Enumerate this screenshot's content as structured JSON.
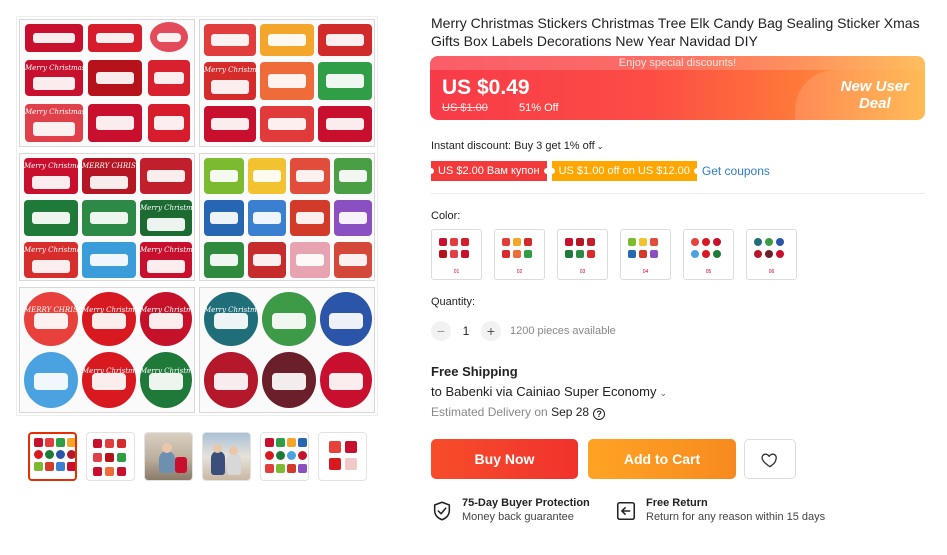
{
  "product": {
    "title": "Merry Christmas Stickers Christmas Tree Elk Candy Bag Sealing Sticker Xmas Gifts Box Labels Decorations New Year Navidad DIY"
  },
  "gallery": {
    "thumbnails": [
      "thumb-1",
      "thumb-2",
      "thumb-3",
      "thumb-4",
      "thumb-5",
      "thumb-6"
    ],
    "active_index": 0,
    "sticker_text": {
      "merry_christmas": "Merry Christmas",
      "merry_christmas_caps": "MERRY CHRISTMAS"
    }
  },
  "price": {
    "promo_strip": "Enjoy special discounts!",
    "current": "US $0.49",
    "original": "US $1.00",
    "discount": "51% Off",
    "deal_line1": "New User",
    "deal_line2": "Deal"
  },
  "instant_discount": "Instant discount: Buy 3 get 1% off",
  "coupons": {
    "coupon1": "US $2.00 Вам купон",
    "coupon2": "US $1.00 off on US $12.00",
    "link": "Get coupons"
  },
  "color": {
    "label": "Color:",
    "options": [
      "01",
      "02",
      "03",
      "04",
      "05",
      "06"
    ]
  },
  "quantity": {
    "label": "Quantity:",
    "minus": "−",
    "plus": "+",
    "value": "1",
    "available": "1200 pieces available"
  },
  "shipping": {
    "title": "Free Shipping",
    "to": "to Babenki via Cainiao Super Economy",
    "estimated_label": "Estimated Delivery on",
    "date": "Sep 28",
    "help": "?"
  },
  "actions": {
    "buy_now": "Buy Now",
    "add_to_cart": "Add to Cart"
  },
  "guarantees": {
    "protection_title": "75-Day Buyer Protection",
    "protection_sub": "Money back guarantee",
    "return_title": "Free Return",
    "return_sub": "Return for any reason within 15 days"
  },
  "colors": {
    "brand_red": "#e62e04",
    "link_blue": "#2e7cc9",
    "cart_orange": "#ffa324",
    "buy_red": "#f0322d"
  }
}
